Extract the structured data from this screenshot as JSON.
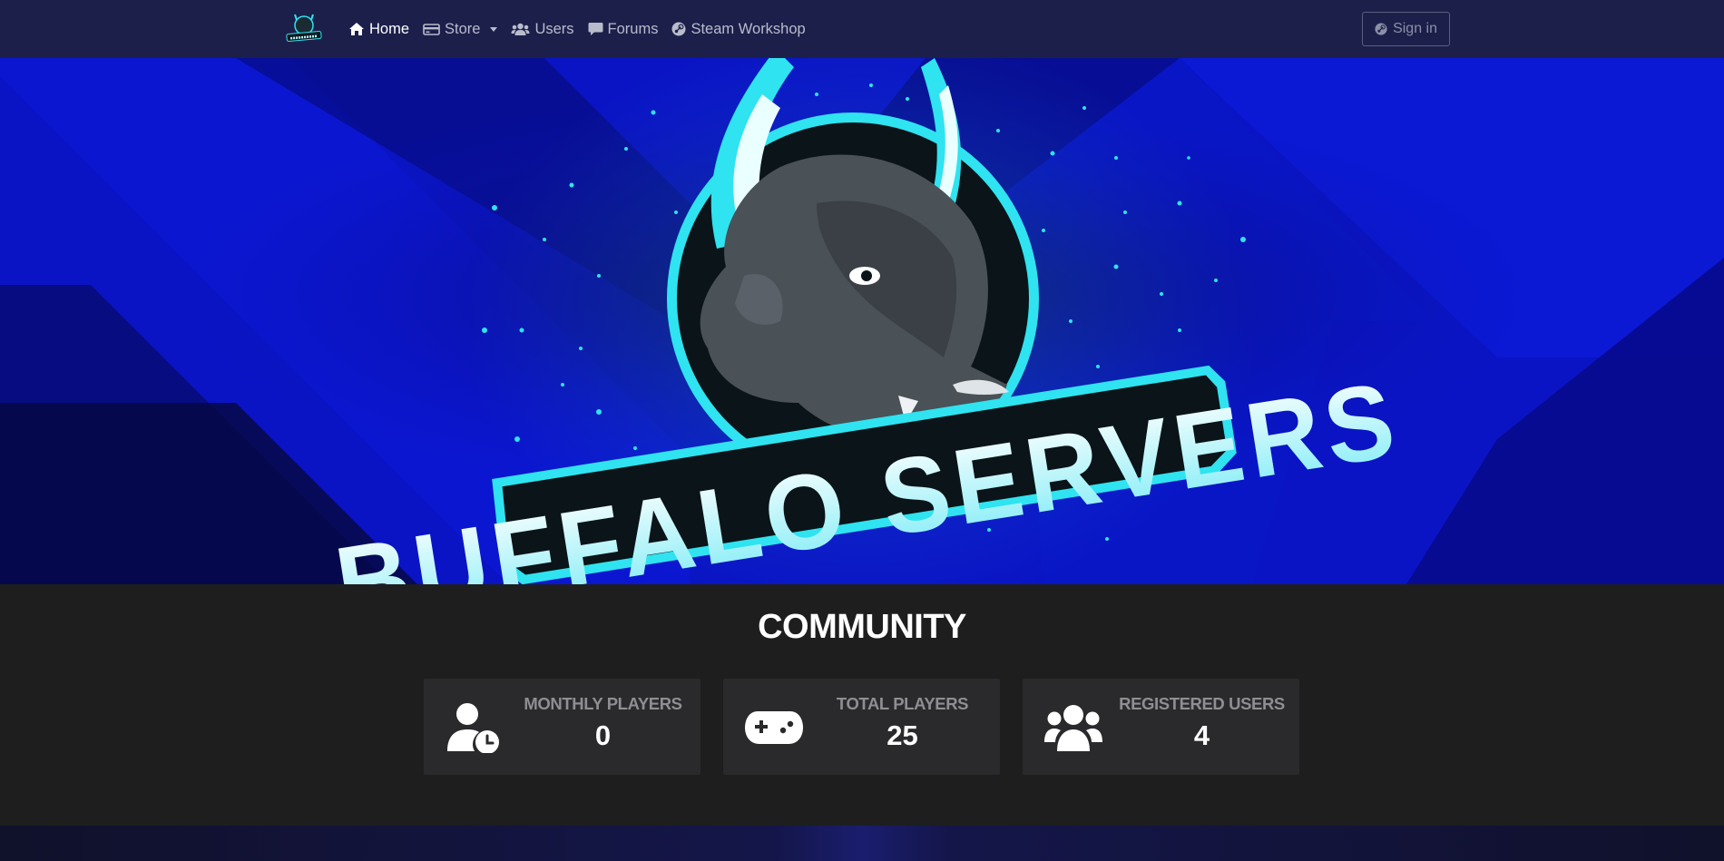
{
  "nav": {
    "links": [
      {
        "label": "Home",
        "icon": "home-icon",
        "active": true
      },
      {
        "label": "Store",
        "icon": "store-icon",
        "dropdown": true
      },
      {
        "label": "Users",
        "icon": "users-icon"
      },
      {
        "label": "Forums",
        "icon": "forums-icon"
      },
      {
        "label": "Steam Workshop",
        "icon": "steam-icon"
      }
    ],
    "signin_label": "Sign in"
  },
  "hero": {
    "logo_text": "BUFFALO SERVERS"
  },
  "community": {
    "title": "COMMUNITY",
    "stats": [
      {
        "label": "MONTHLY PLAYERS",
        "value": "0",
        "icon": "user-clock-icon"
      },
      {
        "label": "TOTAL PLAYERS",
        "value": "25",
        "icon": "gamepad-icon"
      },
      {
        "label": "REGISTERED USERS",
        "value": "4",
        "icon": "user-group-icon"
      }
    ]
  },
  "colors": {
    "navbar_bg": "#1c1f4a",
    "hero_blue": "#0a12b8",
    "accent_cyan": "#2fe3f0",
    "section_bg": "#1e1e1e",
    "card_bg": "#2a2a2d"
  }
}
